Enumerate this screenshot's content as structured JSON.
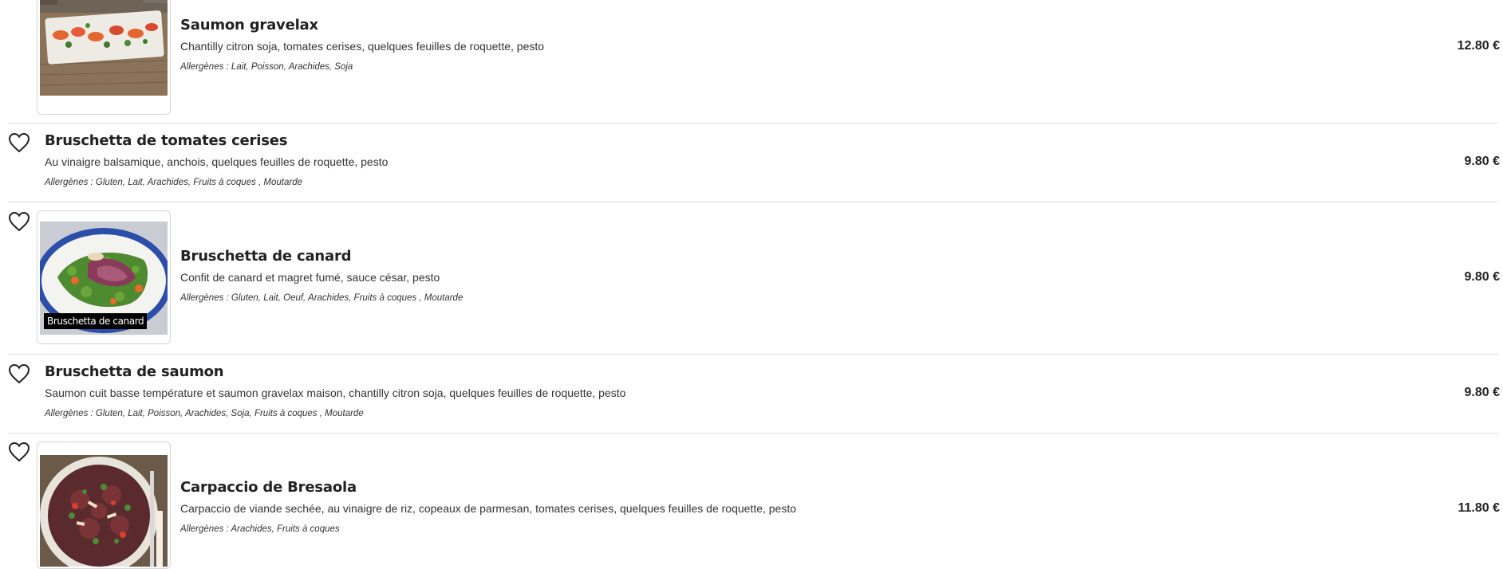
{
  "icons": {
    "favorite": "heart-outline-icon"
  },
  "items": [
    {
      "name": "Saumon gravelax",
      "description": "Chantilly citron soja, tomates cerises, quelques feuilles de roquette, pesto",
      "allergens": "Allergènes : Lait, Poisson, Arachides, Soja",
      "price": "12.80 €"
    },
    {
      "name": "Bruschetta de tomates cerises",
      "description": "Au vinaigre balsamique, anchois, quelques feuilles de roquette, pesto",
      "allergens": "Allergènes : Gluten, Lait, Arachides, Fruits à coques , Moutarde",
      "price": "9.80 €"
    },
    {
      "name": "Bruschetta de canard",
      "description": "Confit de canard et magret fumé, sauce césar, pesto",
      "allergens": "Allergènes : Gluten, Lait, Oeuf, Arachides, Fruits à coques , Moutarde",
      "price": "9.80 €",
      "photo_caption": "Bruschetta de canard"
    },
    {
      "name": "Bruschetta de saumon",
      "description": "Saumon cuit basse température et saumon gravelax maison, chantilly citron soja, quelques feuilles de roquette, pesto",
      "allergens": "Allergènes : Gluten, Lait, Poisson, Arachides, Soja, Fruits à coques , Moutarde",
      "price": "9.80 €"
    },
    {
      "name": "Carpaccio de Bresaola",
      "description": "Carpaccio de viande sechée, au vinaigre de riz, copeaux de parmesan, tomates cerises, quelques feuilles de roquette, pesto",
      "allergens": "Allergènes : Arachides, Fruits à coques",
      "price": "11.80 €"
    }
  ]
}
